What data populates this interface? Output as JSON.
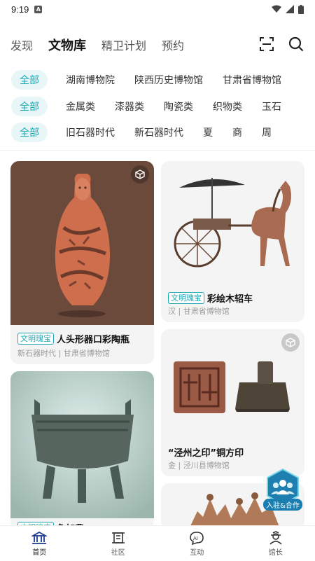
{
  "status_bar": {
    "time": "9:19",
    "notif_icon": "A"
  },
  "top_nav": {
    "tabs": [
      {
        "label": "发现",
        "active": false
      },
      {
        "label": "文物库",
        "active": true
      },
      {
        "label": "精卫计划",
        "active": false
      },
      {
        "label": "预约",
        "active": false
      }
    ]
  },
  "filters": {
    "museums": [
      "全部",
      "湖南博物院",
      "陕西历史博物馆",
      "甘肃省博物馆"
    ],
    "categories": [
      "全部",
      "金属类",
      "漆器类",
      "陶瓷类",
      "织物类",
      "玉石"
    ],
    "eras": [
      "全部",
      "旧石器时代",
      "新石器时代",
      "夏",
      "商",
      "周"
    ]
  },
  "cards": [
    {
      "badge": "文明瑰宝",
      "title": "人头形器口彩陶瓶",
      "sub": "新石器时代 | 甘肃省博物馆"
    },
    {
      "badge": "文明瑰宝",
      "title": "彩绘木轺车",
      "sub": "汉 | 甘肃省博物馆"
    },
    {
      "title": "“泾州之印”铜方印",
      "sub": "金 | 泾川县博物馆"
    },
    {
      "badge": "文明瑰宝",
      "title": "兔加鼎"
    }
  ],
  "fab": {
    "label": "入驻&合作"
  },
  "bottom_nav": [
    {
      "label": "首页",
      "icon": "museum-icon"
    },
    {
      "label": "社区",
      "icon": "scroll-icon"
    },
    {
      "label": "互动",
      "icon": "ai-icon"
    },
    {
      "label": "馆长",
      "icon": "curator-icon"
    }
  ],
  "colors": {
    "accent": "#1aa8b3",
    "chip_bg": "#e8f6f7"
  }
}
